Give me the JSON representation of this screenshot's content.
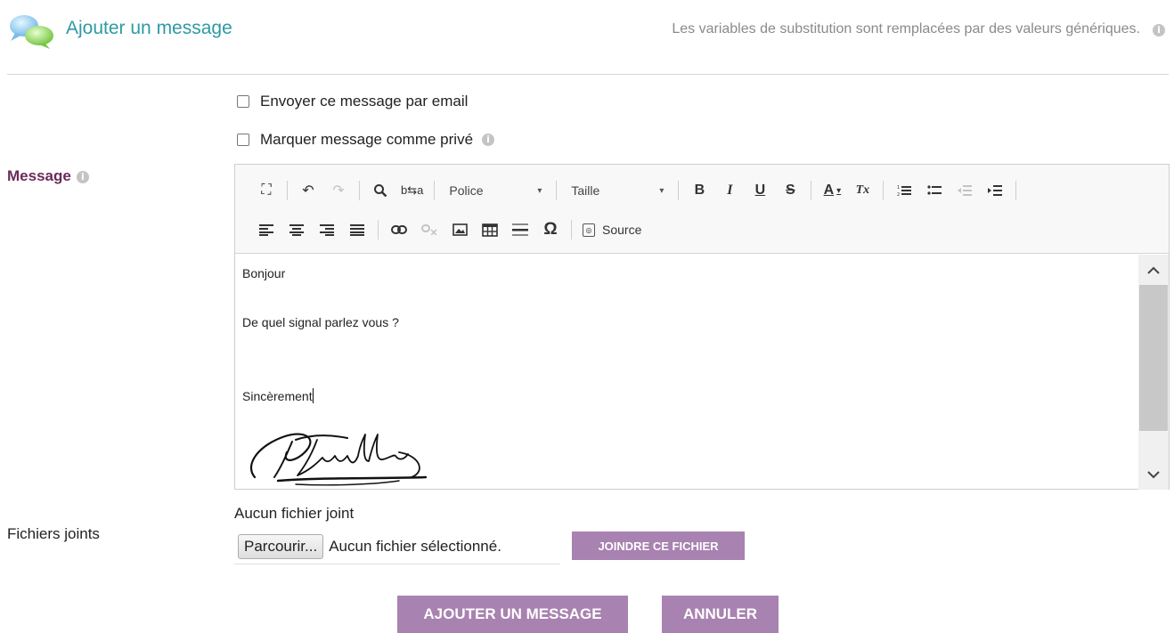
{
  "header": {
    "title": "Ajouter un message",
    "note": "Les variables de substitution sont remplacées par des valeurs génériques.",
    "icon": "chat-bubbles-icon"
  },
  "options": {
    "email_label": "Envoyer ce message par email",
    "email_checked": false,
    "private_label": "Marquer message comme privé",
    "private_checked": false
  },
  "fields": {
    "message_label": "Message",
    "attachments_label": "Fichiers joints"
  },
  "toolbar": {
    "font_label": "Police",
    "size_label": "Taille",
    "source_label": "Source",
    "bold_glyph": "B",
    "italic_glyph": "I",
    "underline_glyph": "U",
    "strike_glyph": "S",
    "color_glyph": "A",
    "clear_format_glyph": "Tx",
    "special_char_glyph": "Ω"
  },
  "editor": {
    "line1": "Bonjour",
    "line2": "De quel signal parlez vous ?",
    "line3": "Sincèrement",
    "signature": "B Franklin"
  },
  "attachments": {
    "none_attached": "Aucun fichier joint",
    "browse_label": "Parcourir...",
    "no_file_selected": "Aucun fichier sélectionné.",
    "join_label": "JOINDRE CE FICHIER"
  },
  "actions": {
    "add_label": "AJOUTER UN MESSAGE",
    "cancel_label": "ANNULER"
  },
  "colors": {
    "accent": "#a882b0",
    "title": "#2e9aa3",
    "label": "#6b2a5a",
    "muted": "#8a8a8a"
  }
}
